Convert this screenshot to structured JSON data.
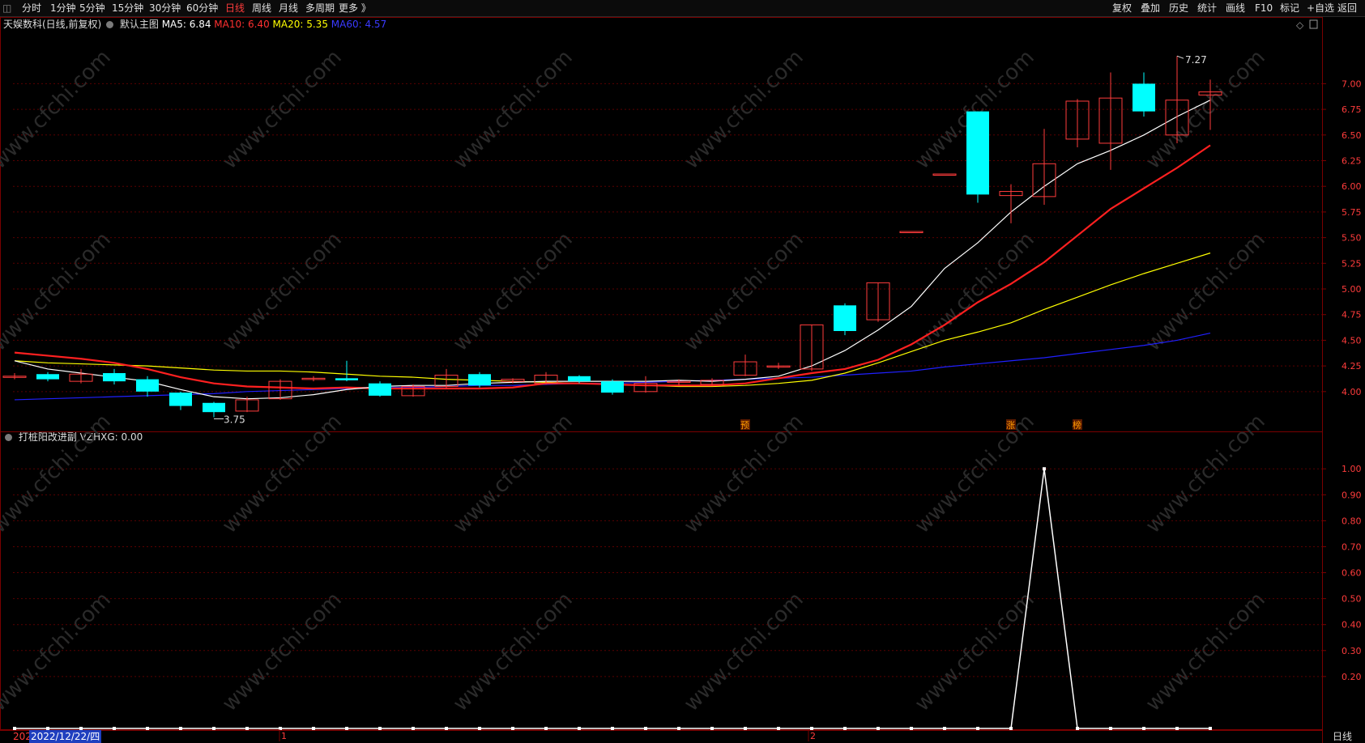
{
  "toolbar": {
    "left": [
      "分时",
      "1分钟",
      "5分钟",
      "15分钟",
      "30分钟",
      "60分钟",
      "日线",
      "周线",
      "月线",
      "多周期",
      "更多 》"
    ],
    "active": "日线",
    "right": [
      "复权",
      "叠加",
      "历史",
      "统计",
      "画线",
      "F10",
      "标记",
      "+自选",
      "返回"
    ]
  },
  "main_info": {
    "stock": "天娱数科(日线,前复权)",
    "template": "默认主图",
    "ma5": "MA5: 6.84",
    "ma10": "MA10: 6.40",
    "ma20": "MA20: 5.35",
    "ma60": "MA60: 4.57"
  },
  "sub_info": {
    "indicator": "打桩阳改进副",
    "value": "VZHXG: 0.00"
  },
  "colors": {
    "up": "#ff3c3c",
    "down": "#00ffff",
    "ma5": "#ffffff",
    "ma10": "#ff2020",
    "ma20": "#ffff00",
    "ma60": "#2020ff",
    "grid": "#5a0000"
  },
  "watermark": "www.cfchi.com",
  "footer": {
    "date": "2022/12/22/四",
    "period": "日线",
    "year_prefix": "202",
    "marks": [
      "1",
      "2"
    ]
  },
  "chart_data": [
    {
      "type": "candlestick",
      "yticks": [
        4.0,
        4.25,
        4.5,
        4.75,
        5.0,
        5.25,
        5.5,
        5.75,
        6.0,
        6.25,
        6.5,
        6.75,
        7.0
      ],
      "ylim": [
        3.62,
        7.5
      ],
      "annotations": {
        "high": "7.27",
        "low": "3.75",
        "signals": [
          "预",
          "涨",
          "榜"
        ]
      },
      "candles": [
        {
          "o": 4.15,
          "c": 4.15,
          "h": 4.18,
          "l": 4.12
        },
        {
          "o": 4.17,
          "c": 4.12,
          "h": 4.19,
          "l": 4.1
        },
        {
          "o": 4.1,
          "c": 4.17,
          "h": 4.22,
          "l": 4.08
        },
        {
          "o": 4.18,
          "c": 4.1,
          "h": 4.22,
          "l": 4.07
        },
        {
          "o": 4.12,
          "c": 4.0,
          "h": 4.15,
          "l": 3.95
        },
        {
          "o": 3.99,
          "c": 3.86,
          "h": 4.0,
          "l": 3.82
        },
        {
          "o": 3.89,
          "c": 3.8,
          "h": 3.9,
          "l": 3.75
        },
        {
          "o": 3.81,
          "c": 3.92,
          "h": 3.95,
          "l": 3.8
        },
        {
          "o": 3.93,
          "c": 4.1,
          "h": 4.12,
          "l": 3.92
        },
        {
          "o": 4.12,
          "c": 4.13,
          "h": 4.15,
          "l": 4.1
        },
        {
          "o": 4.13,
          "c": 4.11,
          "h": 4.3,
          "l": 4.1
        },
        {
          "o": 4.08,
          "c": 3.96,
          "h": 4.1,
          "l": 3.95
        },
        {
          "o": 3.96,
          "c": 4.05,
          "h": 4.07,
          "l": 3.95
        },
        {
          "o": 4.05,
          "c": 4.16,
          "h": 4.22,
          "l": 4.03
        },
        {
          "o": 4.17,
          "c": 4.06,
          "h": 4.19,
          "l": 4.04
        },
        {
          "o": 4.1,
          "c": 4.12,
          "h": 4.13,
          "l": 4.08
        },
        {
          "o": 4.08,
          "c": 4.16,
          "h": 4.19,
          "l": 4.07
        },
        {
          "o": 4.15,
          "c": 4.1,
          "h": 4.16,
          "l": 4.08
        },
        {
          "o": 4.1,
          "c": 3.99,
          "h": 4.12,
          "l": 3.97
        },
        {
          "o": 4.0,
          "c": 4.08,
          "h": 4.15,
          "l": 3.99
        },
        {
          "o": 4.09,
          "c": 4.1,
          "h": 4.12,
          "l": 4.06
        },
        {
          "o": 4.07,
          "c": 4.11,
          "h": 4.13,
          "l": 4.06
        },
        {
          "o": 4.16,
          "c": 4.29,
          "h": 4.36,
          "l": 4.15
        },
        {
          "o": 4.25,
          "c": 4.25,
          "h": 4.28,
          "l": 4.22
        },
        {
          "o": 4.22,
          "c": 4.65,
          "h": 4.65,
          "l": 4.2
        },
        {
          "o": 4.84,
          "c": 4.59,
          "h": 4.86,
          "l": 4.55
        },
        {
          "o": 4.7,
          "c": 5.06,
          "h": 5.06,
          "l": 4.68
        },
        {
          "o": 5.56,
          "c": 5.56,
          "h": 5.56,
          "l": 5.56
        },
        {
          "o": 6.12,
          "c": 6.12,
          "h": 6.12,
          "l": 6.12
        },
        {
          "o": 6.73,
          "c": 5.92,
          "h": 6.73,
          "l": 5.84
        },
        {
          "o": 5.91,
          "c": 5.95,
          "h": 6.02,
          "l": 5.64
        },
        {
          "o": 5.9,
          "c": 6.22,
          "h": 6.56,
          "l": 5.82
        },
        {
          "o": 6.46,
          "c": 6.83,
          "h": 6.85,
          "l": 6.38
        },
        {
          "o": 6.42,
          "c": 6.86,
          "h": 7.11,
          "l": 6.16
        },
        {
          "o": 7.0,
          "c": 6.73,
          "h": 7.11,
          "l": 6.68
        },
        {
          "o": 6.5,
          "c": 6.84,
          "h": 7.27,
          "l": 6.42
        },
        {
          "o": 6.89,
          "c": 6.92,
          "h": 7.04,
          "l": 6.55
        }
      ],
      "ma5": [
        4.3,
        4.22,
        4.18,
        4.14,
        4.1,
        4.02,
        3.95,
        3.93,
        3.94,
        3.97,
        4.02,
        4.05,
        4.06,
        4.06,
        4.08,
        4.09,
        4.1,
        4.1,
        4.1,
        4.1,
        4.11,
        4.1,
        4.12,
        4.15,
        4.25,
        4.4,
        4.6,
        4.83,
        5.2,
        5.45,
        5.75,
        6.0,
        6.22,
        6.35,
        6.5,
        6.68,
        6.84
      ],
      "ma10": [
        4.38,
        4.35,
        4.32,
        4.28,
        4.22,
        4.14,
        4.08,
        4.05,
        4.04,
        4.03,
        4.04,
        4.03,
        4.03,
        4.03,
        4.03,
        4.04,
        4.08,
        4.08,
        4.07,
        4.06,
        4.06,
        4.06,
        4.08,
        4.13,
        4.18,
        4.22,
        4.31,
        4.46,
        4.65,
        4.87,
        5.05,
        5.26,
        5.52,
        5.78,
        5.98,
        6.18,
        6.4
      ],
      "ma20": [
        4.3,
        4.28,
        4.27,
        4.26,
        4.25,
        4.23,
        4.21,
        4.2,
        4.2,
        4.19,
        4.17,
        4.15,
        4.14,
        4.12,
        4.11,
        4.1,
        4.09,
        4.08,
        4.07,
        4.06,
        4.05,
        4.05,
        4.06,
        4.08,
        4.11,
        4.18,
        4.28,
        4.39,
        4.5,
        4.58,
        4.67,
        4.8,
        4.92,
        5.04,
        5.15,
        5.25,
        5.35
      ],
      "ma60": [
        3.92,
        3.93,
        3.94,
        3.95,
        3.96,
        3.97,
        3.98,
        4.0,
        4.01,
        4.02,
        4.03,
        4.04,
        4.04,
        4.05,
        4.06,
        4.06,
        4.07,
        4.08,
        4.08,
        4.09,
        4.1,
        4.11,
        4.12,
        4.13,
        4.14,
        4.16,
        4.18,
        4.2,
        4.24,
        4.27,
        4.3,
        4.33,
        4.37,
        4.41,
        4.45,
        4.5,
        4.57
      ]
    },
    {
      "type": "line",
      "title": "打桩阳改进副 VZHXG",
      "yticks": [
        0.2,
        0.3,
        0.4,
        0.5,
        0.6,
        0.7,
        0.8,
        0.9,
        1.0
      ],
      "ylim": [
        0,
        1.06
      ],
      "series": [
        {
          "name": "VZHXG",
          "values": [
            0,
            0,
            0,
            0,
            0,
            0,
            0,
            0,
            0,
            0,
            0,
            0,
            0,
            0,
            0,
            0,
            0,
            0,
            0,
            0,
            0,
            0,
            0,
            0,
            0,
            0,
            0,
            0,
            0,
            0,
            0,
            1,
            0,
            0,
            0,
            0,
            0
          ]
        }
      ]
    }
  ]
}
